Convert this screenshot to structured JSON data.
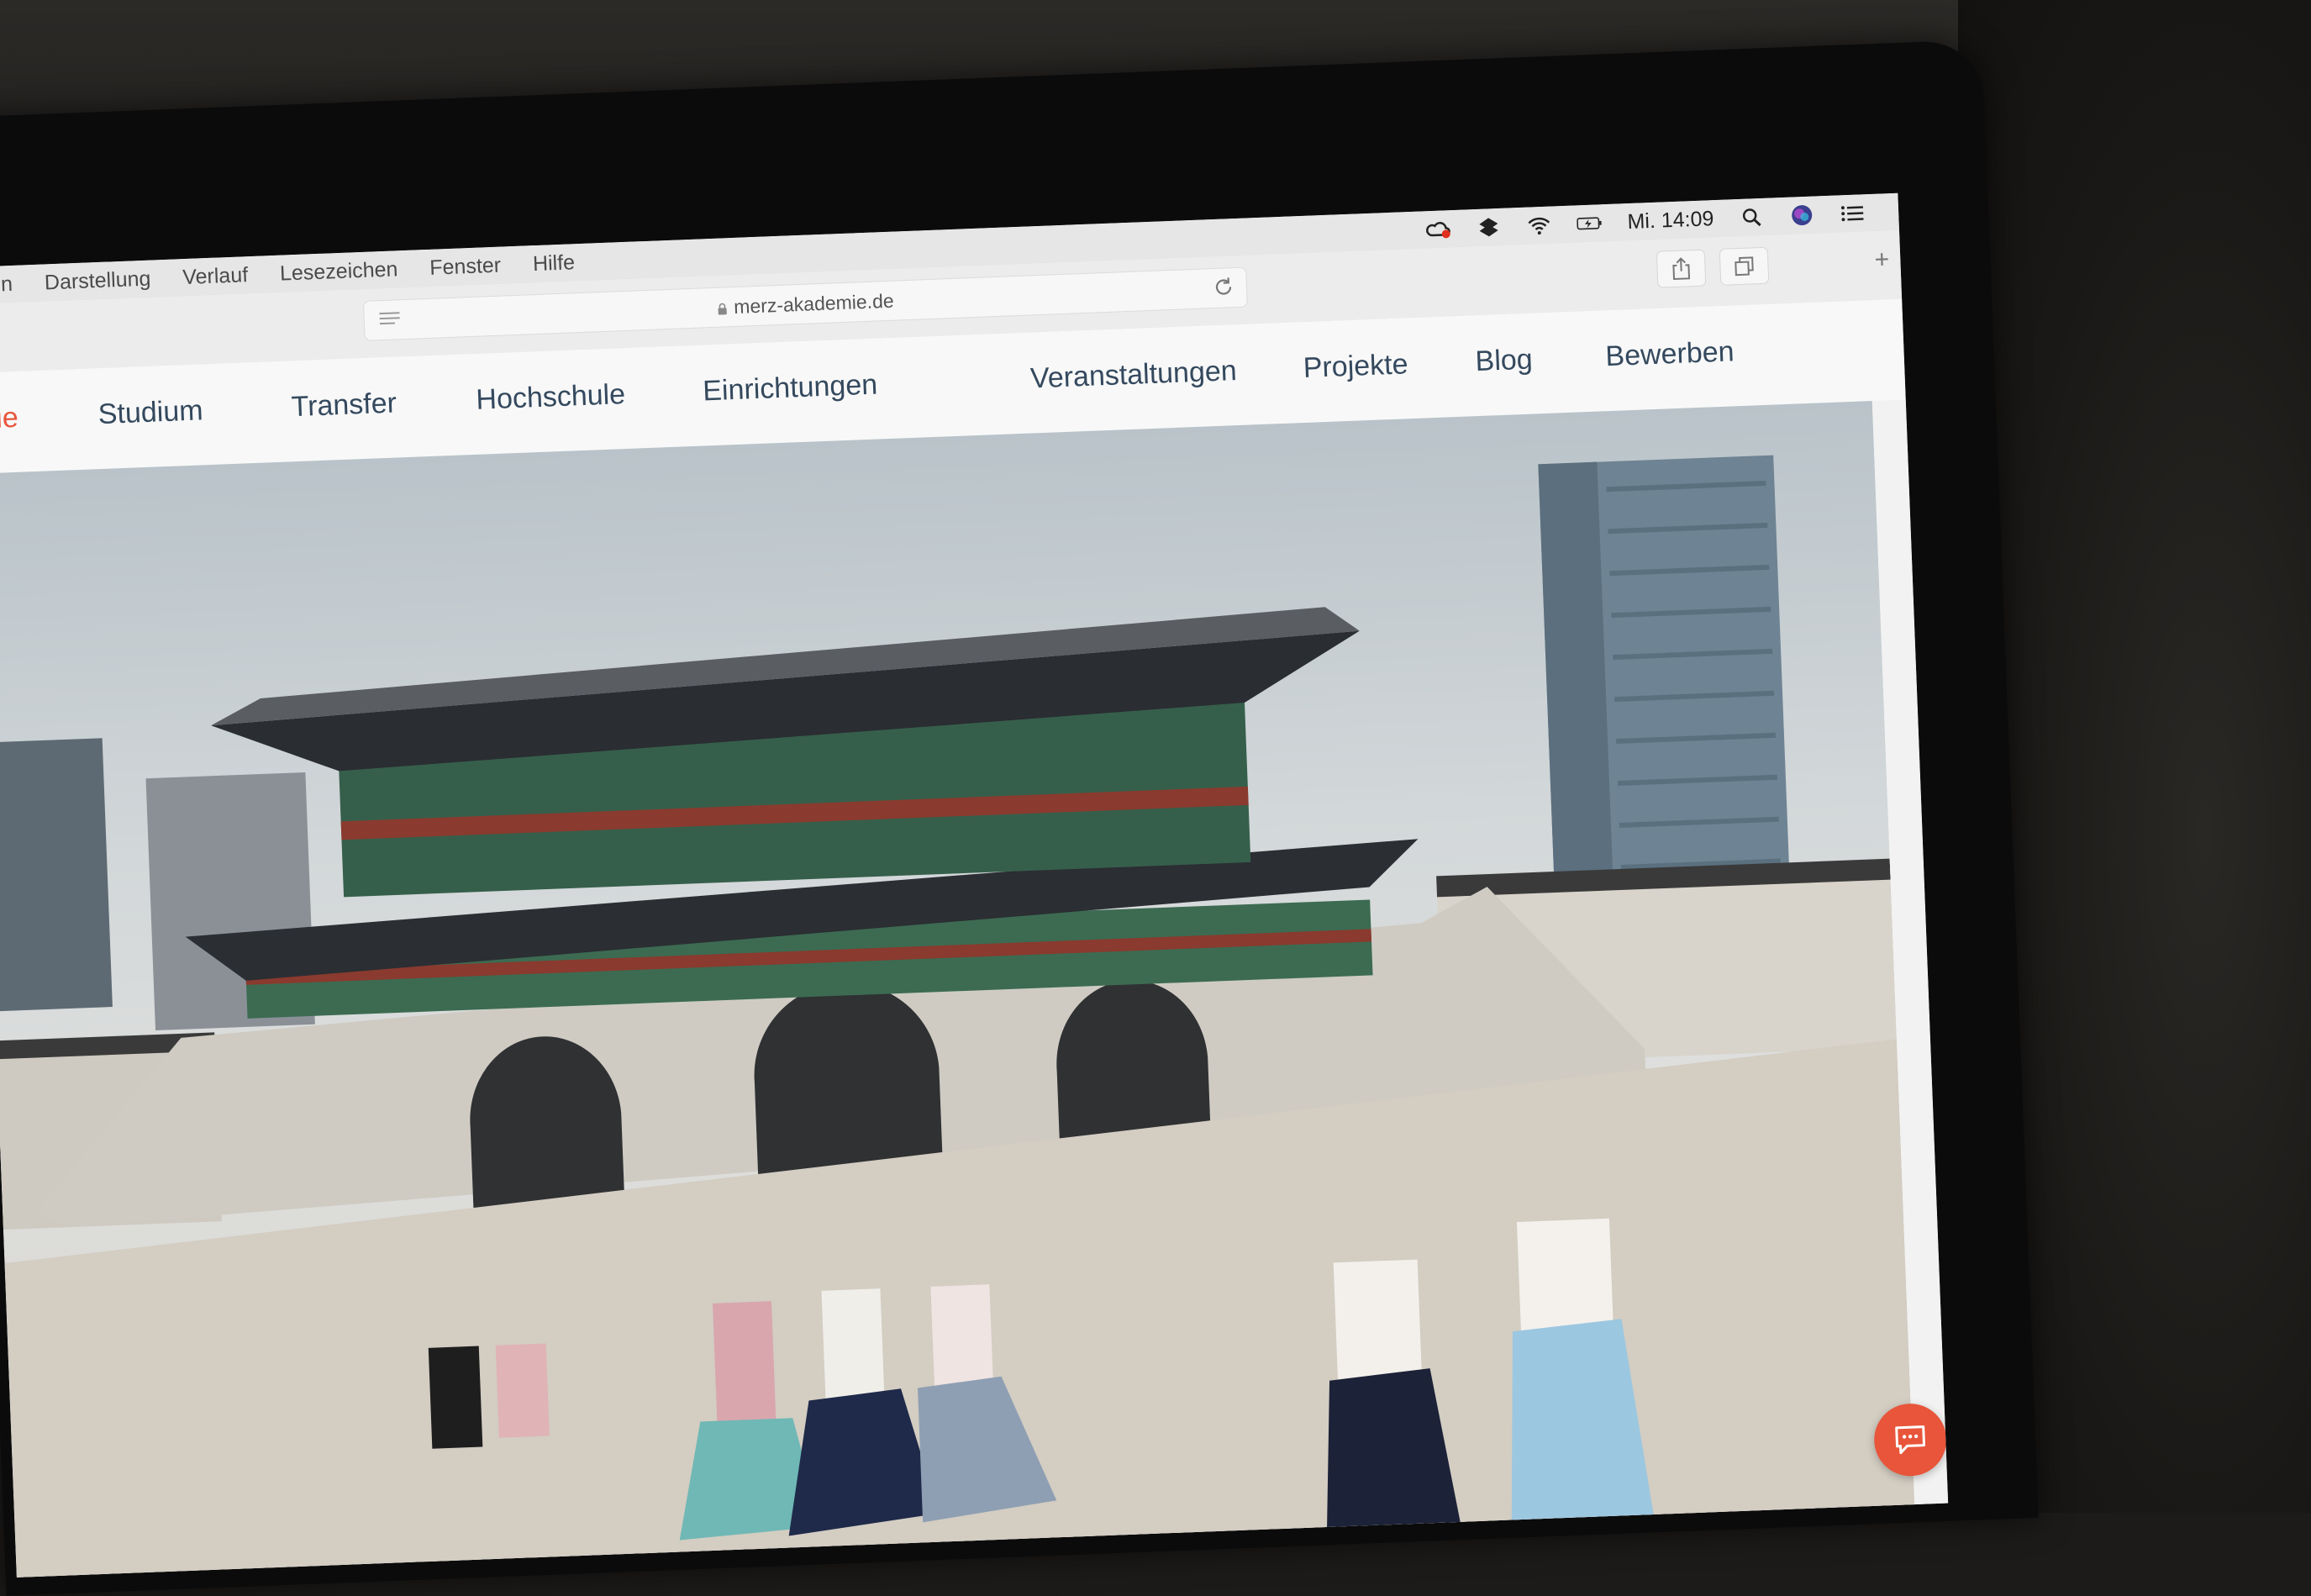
{
  "menubar": {
    "items": [
      "eiten",
      "Darstellung",
      "Verlauf",
      "Lesezeichen",
      "Fenster",
      "Hilfe"
    ],
    "clock": "Mi. 14:09",
    "icons": [
      "creative-cloud-icon",
      "dropbox-icon",
      "wifi-icon",
      "battery-icon",
      "spotlight-search-icon",
      "siri-icon",
      "notification-center-icon"
    ]
  },
  "toolbar": {
    "url": "merz-akademie.de"
  },
  "site_nav": {
    "logo_fragment": "mie",
    "items": [
      "Studium",
      "Transfer",
      "Hochschule",
      "Einrichtungen",
      "Veranstaltungen",
      "Projekte",
      "Blog",
      "Bewerben"
    ]
  },
  "colors": {
    "accent": "#e8553a",
    "nav_text": "#34495e",
    "menubar_bg": "#e6e6e6"
  },
  "hero": {
    "image_subject": "palace-gate-photo"
  },
  "chat": {
    "icon": "chat-bubble-icon"
  }
}
